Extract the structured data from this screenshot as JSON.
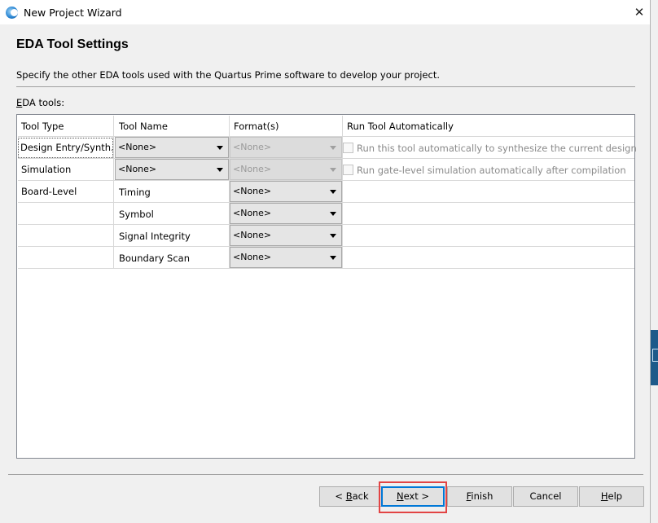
{
  "window": {
    "title": "New Project Wizard",
    "close_glyph": "✕"
  },
  "page": {
    "heading": "EDA Tool Settings",
    "description": "Specify the other EDA tools used with the Quartus Prime software to develop your project.",
    "tools_label_first": "E",
    "tools_label_rest": "DA tools:"
  },
  "table": {
    "headers": [
      "Tool Type",
      "Tool Name",
      "Format(s)",
      "Run Tool Automatically"
    ],
    "rows": [
      {
        "tool_type": "Design Entry/Synth...",
        "tool_name": "<None>",
        "format": "<None>",
        "run_option": "Run this tool automatically to synthesize the current design"
      },
      {
        "tool_type": "Simulation",
        "tool_name": "<None>",
        "format": "<None>",
        "run_option": "Run gate-level simulation automatically after compilation"
      },
      {
        "tool_type": "Board-Level",
        "tool_name": "Timing",
        "format": "<None>"
      },
      {
        "tool_type": "",
        "tool_name": "Symbol",
        "format": "<None>"
      },
      {
        "tool_type": "",
        "tool_name": "Signal Integrity",
        "format": "<None>"
      },
      {
        "tool_type": "",
        "tool_name": "Boundary Scan",
        "format": "<None>"
      }
    ]
  },
  "buttons": {
    "back": {
      "prefix": "< ",
      "mnemonic": "B",
      "rest": "ack"
    },
    "next": {
      "mnemonic": "N",
      "rest": "ext >"
    },
    "finish": {
      "mnemonic": "F",
      "rest": "inish"
    },
    "cancel": {
      "label": "Cancel"
    },
    "help": {
      "mnemonic": "H",
      "rest": "elp"
    }
  },
  "colors": {
    "panel_background": "#f0f0f0",
    "focus_border": "#0078d7",
    "annotation_highlight": "#e24444"
  }
}
